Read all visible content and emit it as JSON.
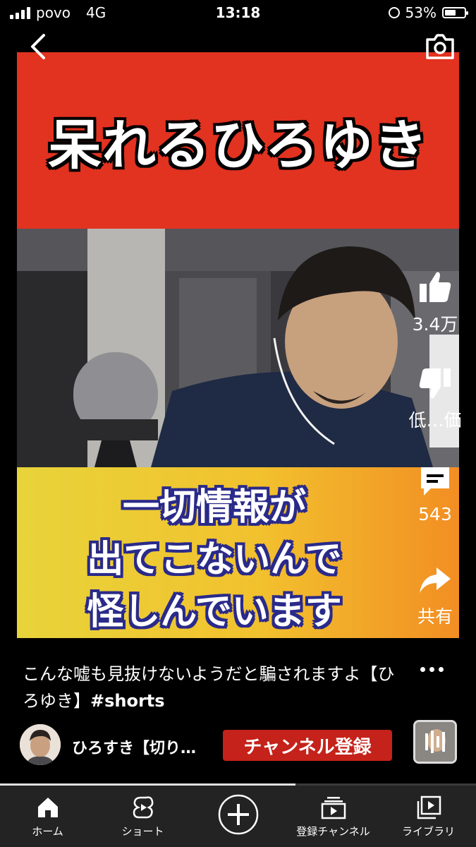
{
  "status_bar": {
    "carrier": "povo",
    "network": "4G",
    "time": "13:18",
    "battery": "53%"
  },
  "video": {
    "top_caption": "呆れるひろゆき",
    "subtitle_lines": [
      "一切情報が",
      "出てこないんで",
      "怪しんでいます"
    ]
  },
  "actions": {
    "like_count": "3.4万",
    "dislike_label": "低…価",
    "comment_count": "543",
    "share_label": "共有"
  },
  "video_title": {
    "text": "こんな嘘も見抜けないようだと騙されますよ【ひろゆき】",
    "hashtag": "#shorts"
  },
  "channel": {
    "name": "ひろすき【切り…",
    "subscribe_label": "チャンネル登録"
  },
  "progress": {
    "fraction": 0.62
  },
  "bottom_nav": {
    "home": "ホーム",
    "shorts": "ショート",
    "subscriptions": "登録チャンネル",
    "library": "ライブラリ"
  },
  "colors": {
    "subscribe": "#c4221a",
    "caption_band": "#e23220",
    "nav_bg": "#232323"
  }
}
